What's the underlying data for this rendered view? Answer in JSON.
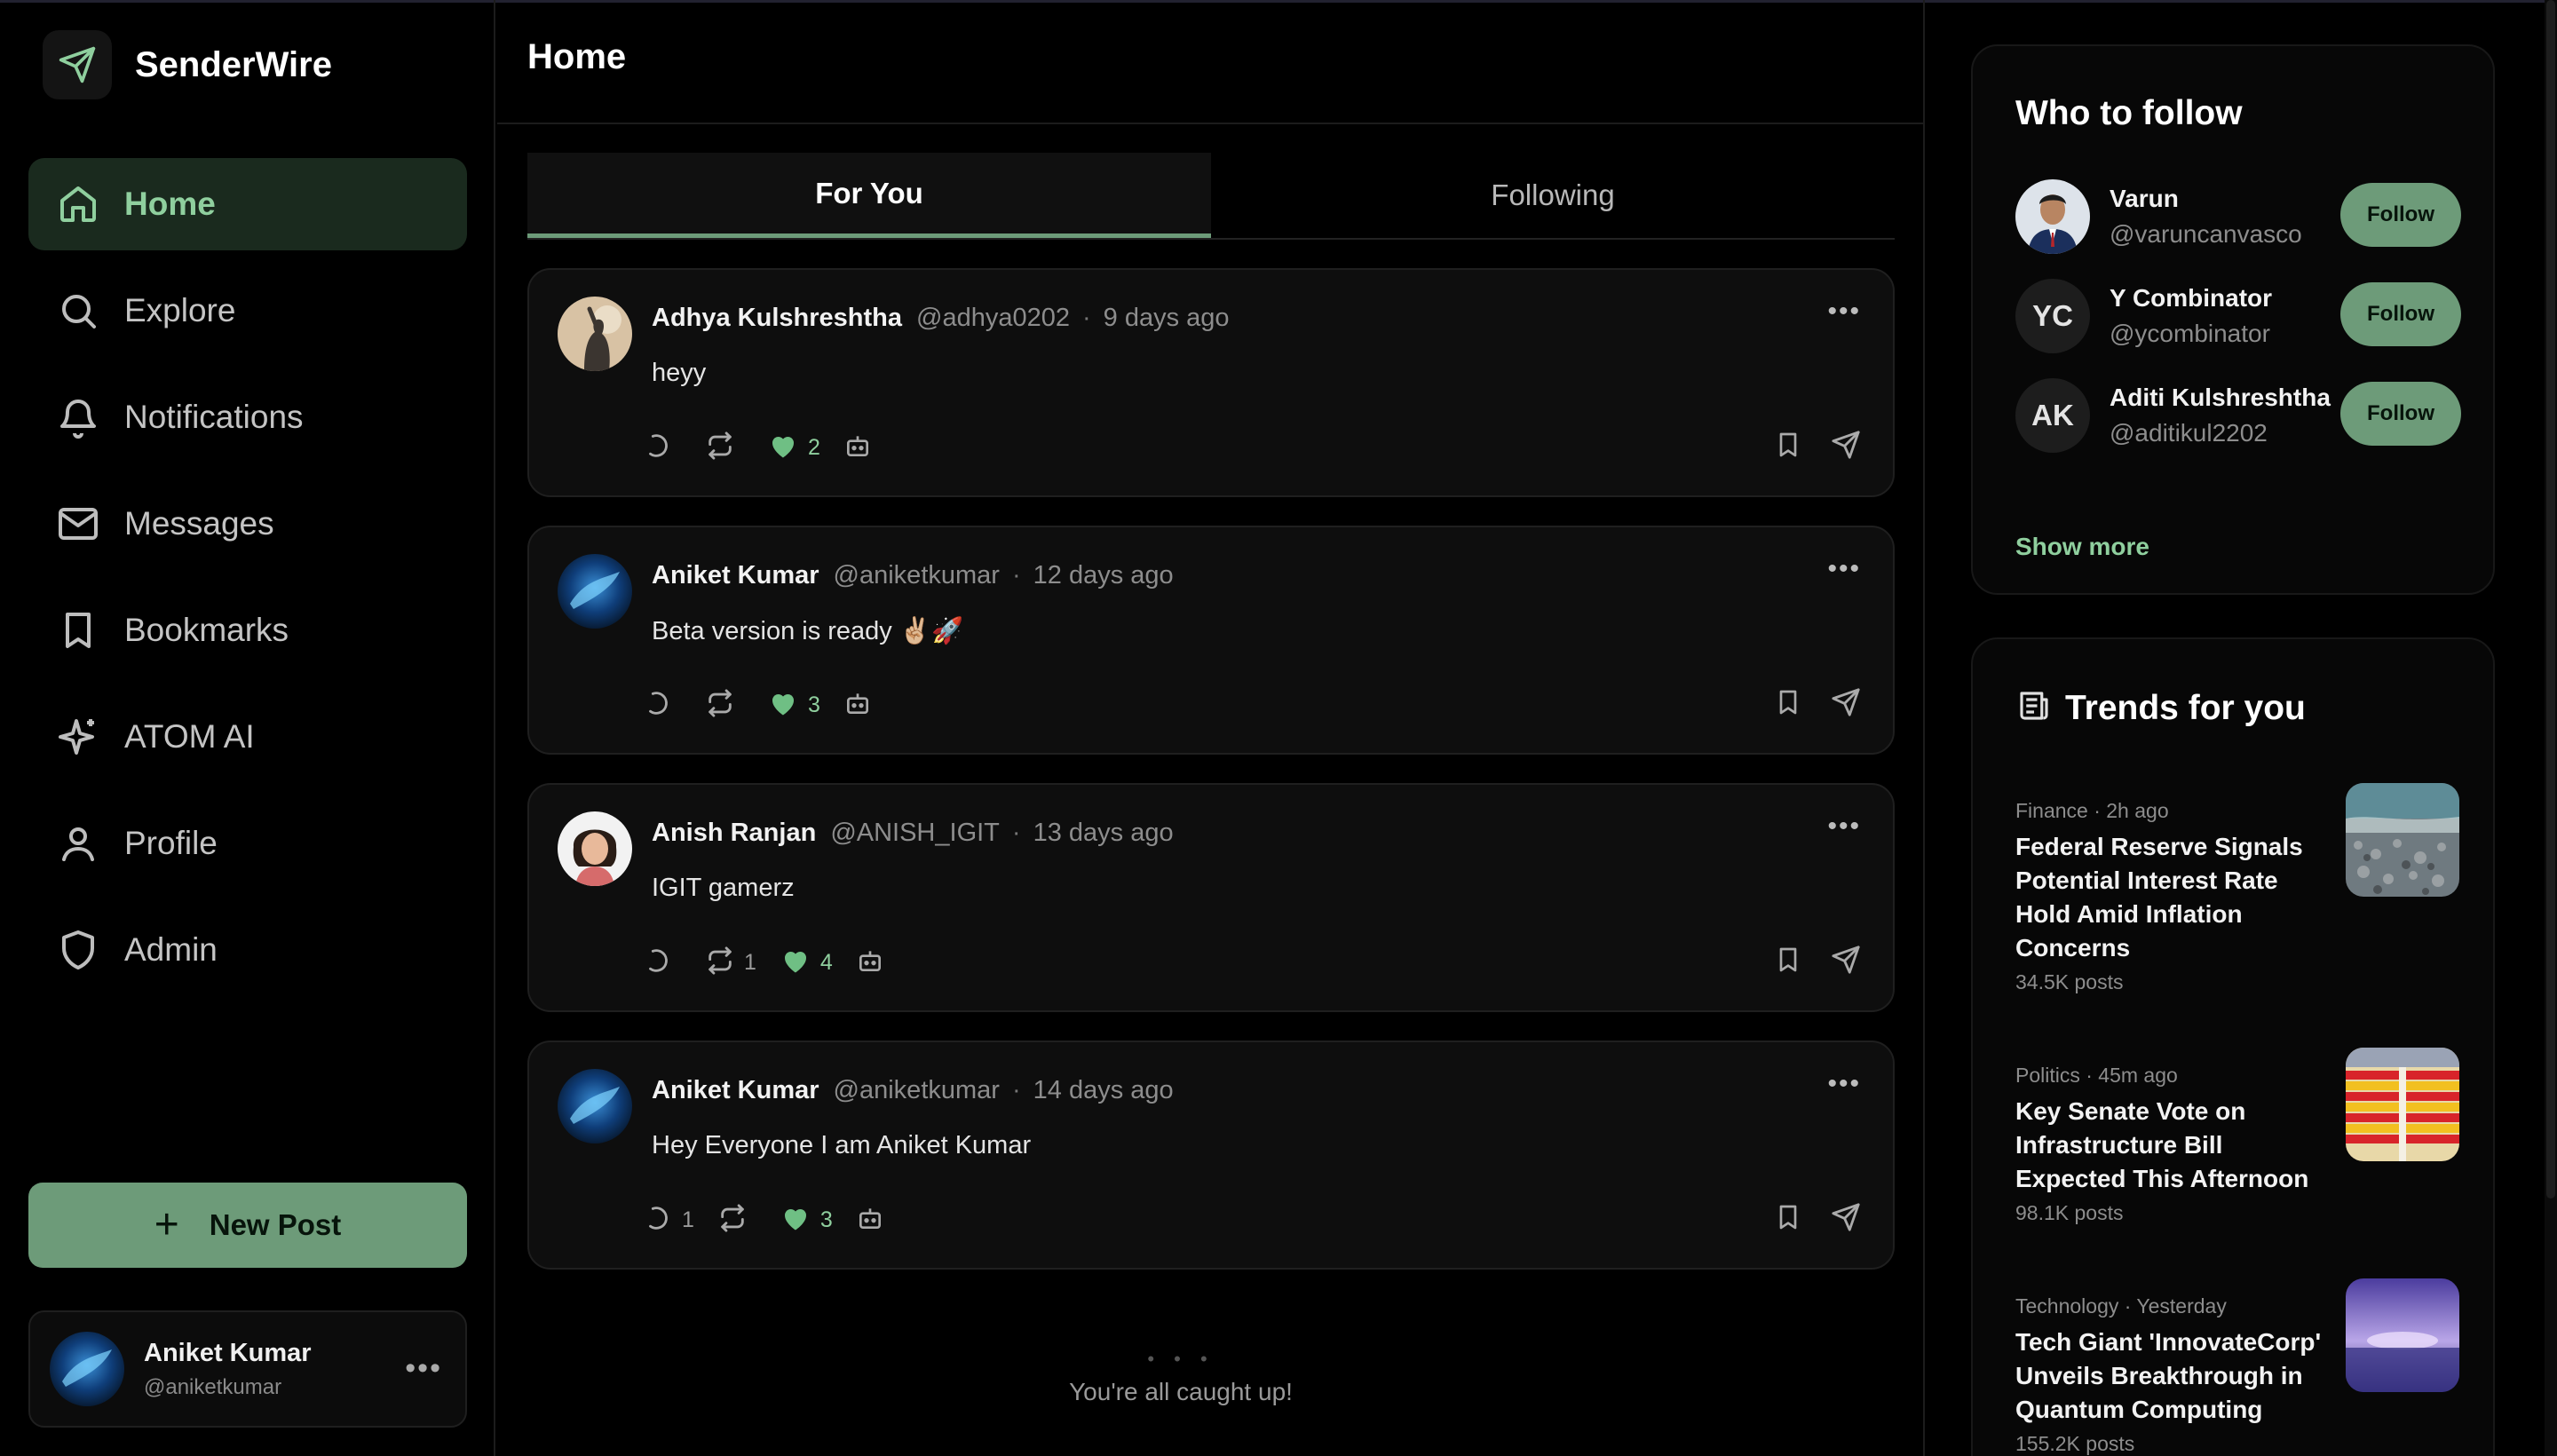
{
  "app": {
    "name": "SenderWire"
  },
  "nav": {
    "items": [
      {
        "label": "Home",
        "icon": "home-icon",
        "active": true
      },
      {
        "label": "Explore",
        "icon": "search-icon"
      },
      {
        "label": "Notifications",
        "icon": "bell-icon"
      },
      {
        "label": "Messages",
        "icon": "mail-icon"
      },
      {
        "label": "Bookmarks",
        "icon": "bookmark-icon"
      },
      {
        "label": "ATOM AI",
        "icon": "sparkle-icon"
      },
      {
        "label": "Profile",
        "icon": "user-icon"
      },
      {
        "label": "Admin",
        "icon": "shield-icon"
      }
    ],
    "new_post_label": "New Post"
  },
  "current_user": {
    "name": "Aniket Kumar",
    "handle": "@aniketkumar"
  },
  "main": {
    "title": "Home",
    "tabs": [
      {
        "label": "For You",
        "active": true
      },
      {
        "label": "Following",
        "active": false
      }
    ],
    "posts": [
      {
        "author": "Adhya Kulshreshtha",
        "handle": "@adhya0202",
        "time": "9 days ago",
        "text": "heyy",
        "replies": "",
        "reposts": "",
        "likes": "2"
      },
      {
        "author": "Aniket Kumar",
        "handle": "@aniketkumar",
        "time": "12 days ago",
        "text": "Beta version is ready ✌🏼🚀",
        "replies": "",
        "reposts": "",
        "likes": "3"
      },
      {
        "author": "Anish Ranjan",
        "handle": "@ANISH_IGIT",
        "time": "13 days ago",
        "text": "IGIT gamerz",
        "replies": "",
        "reposts": "1",
        "likes": "4"
      },
      {
        "author": "Aniket Kumar",
        "handle": "@aniketkumar",
        "time": "14 days ago",
        "text": "Hey Everyone I am Aniket Kumar",
        "replies": "1",
        "reposts": "",
        "likes": "3"
      }
    ],
    "end_message": "You're all caught up!"
  },
  "who_to_follow": {
    "title": "Who to follow",
    "users": [
      {
        "name": "Varun",
        "handle": "@varuncanvasco",
        "initials": "",
        "button": "Follow"
      },
      {
        "name": "Y Combinator",
        "handle": "@ycombinator",
        "initials": "YC",
        "button": "Follow"
      },
      {
        "name": "Aditi Kulshreshtha",
        "handle": "@aditikul2202",
        "initials": "AK",
        "button": "Follow"
      }
    ],
    "show_more": "Show more"
  },
  "trends": {
    "title": "Trends for you",
    "items": [
      {
        "meta": "Finance · 2h ago",
        "title": "Federal Reserve Signals Potential Interest Rate Hold Amid Inflation Concerns",
        "posts": "34.5K posts"
      },
      {
        "meta": "Politics · 45m ago",
        "title": "Key Senate Vote on Infrastructure Bill Expected This Afternoon",
        "posts": "98.1K posts"
      },
      {
        "meta": "Technology · Yesterday",
        "title": "Tech Giant 'InnovateCorp' Unveils Breakthrough in Quantum Computing",
        "posts": "155.2K posts"
      }
    ]
  },
  "colors": {
    "accent": "#6d9b79",
    "accent_text": "#8fcf9e",
    "background": "#000000",
    "card": "#0e0e0e"
  }
}
